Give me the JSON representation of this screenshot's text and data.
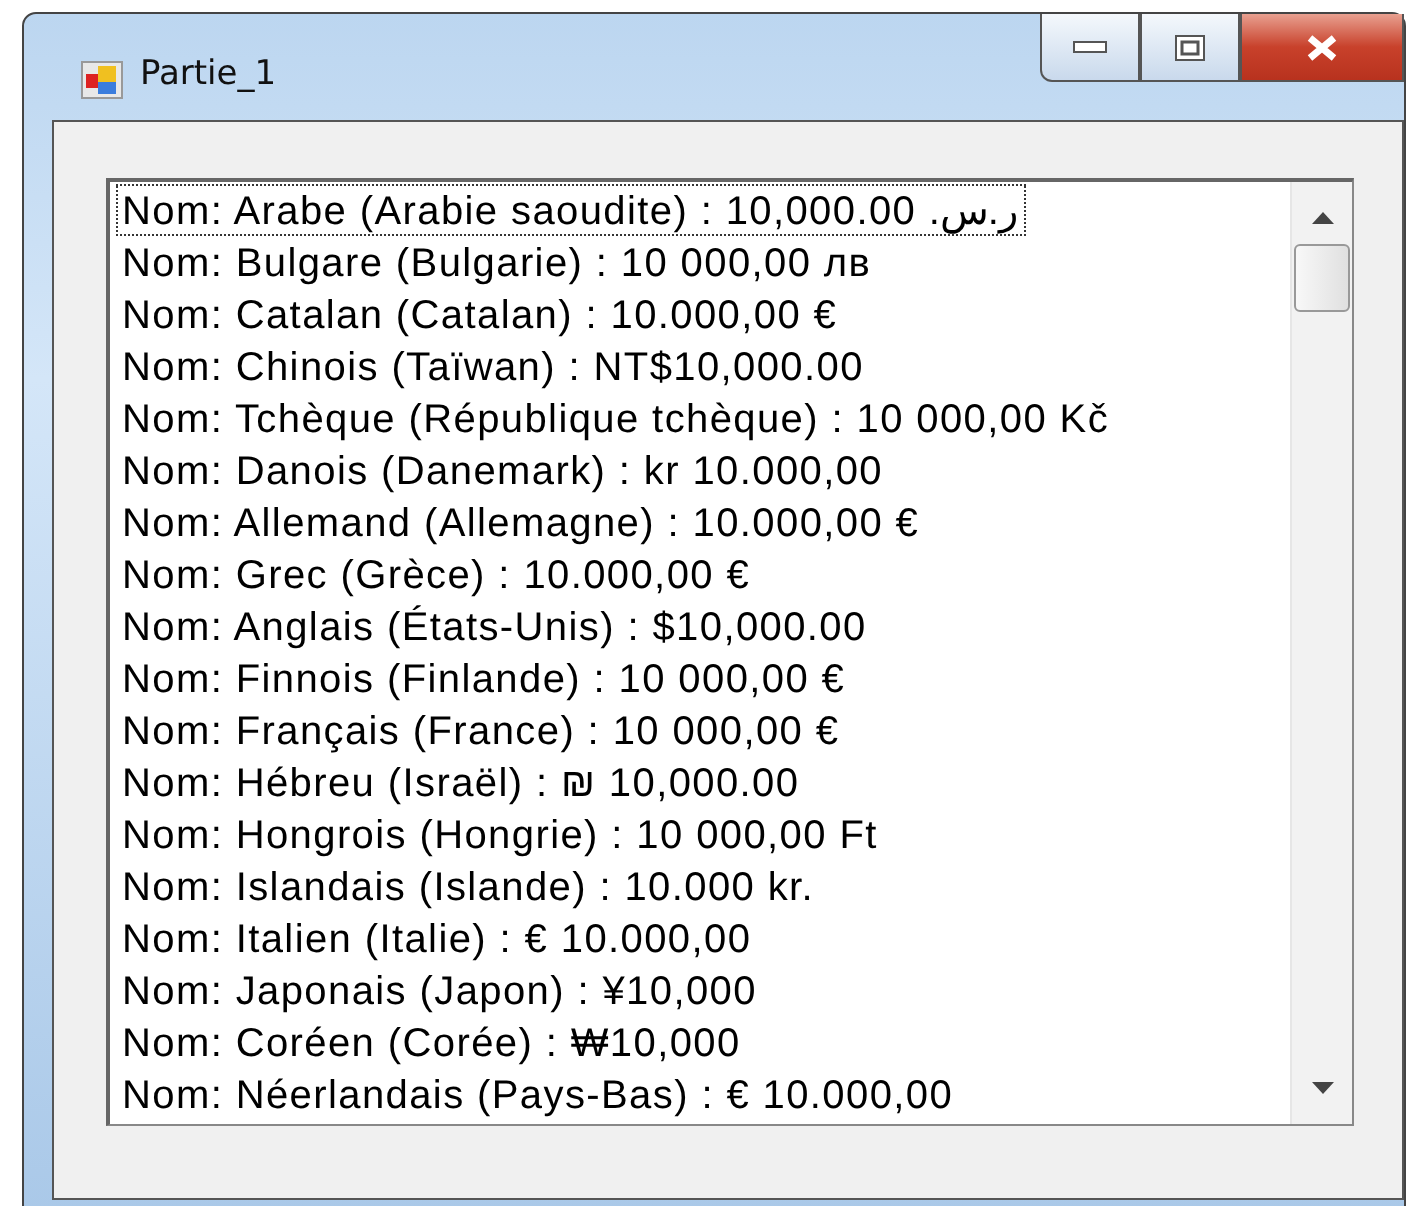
{
  "window": {
    "title": "Partie_1"
  },
  "list": {
    "items": [
      {
        "text": "Nom: Arabe (Arabie saoudite) : 10,000.00 ر.س.‏",
        "focused": true
      },
      {
        "text": "Nom: Bulgare (Bulgarie) : 10 000,00 лв",
        "focused": false
      },
      {
        "text": "Nom: Catalan (Catalan) : 10.000,00 €",
        "focused": false
      },
      {
        "text": "Nom: Chinois (Taïwan) : NT$10,000.00",
        "focused": false
      },
      {
        "text": "Nom: Tchèque (République tchèque) : 10 000,00 Kč",
        "focused": false
      },
      {
        "text": "Nom: Danois (Danemark) : kr 10.000,00",
        "focused": false
      },
      {
        "text": "Nom: Allemand (Allemagne) : 10.000,00 €",
        "focused": false
      },
      {
        "text": "Nom: Grec (Grèce) : 10.000,00 €",
        "focused": false
      },
      {
        "text": "Nom: Anglais (États-Unis) : $10,000.00",
        "focused": false
      },
      {
        "text": "Nom: Finnois (Finlande) : 10 000,00 €",
        "focused": false
      },
      {
        "text": "Nom: Français (France) : 10 000,00 €",
        "focused": false
      },
      {
        "text": "Nom: Hébreu (Israël) : ₪ 10,000.00",
        "focused": false
      },
      {
        "text": "Nom: Hongrois (Hongrie) : 10 000,00 Ft",
        "focused": false
      },
      {
        "text": "Nom: Islandais (Islande) : 10.000 kr.",
        "focused": false
      },
      {
        "text": "Nom: Italien (Italie) : € 10.000,00",
        "focused": false
      },
      {
        "text": "Nom: Japonais (Japon) : ¥10,000",
        "focused": false
      },
      {
        "text": "Nom: Coréen (Corée) : ₩10,000",
        "focused": false
      },
      {
        "text": "Nom: Néerlandais (Pays-Bas) : € 10.000,00",
        "focused": false
      }
    ]
  }
}
